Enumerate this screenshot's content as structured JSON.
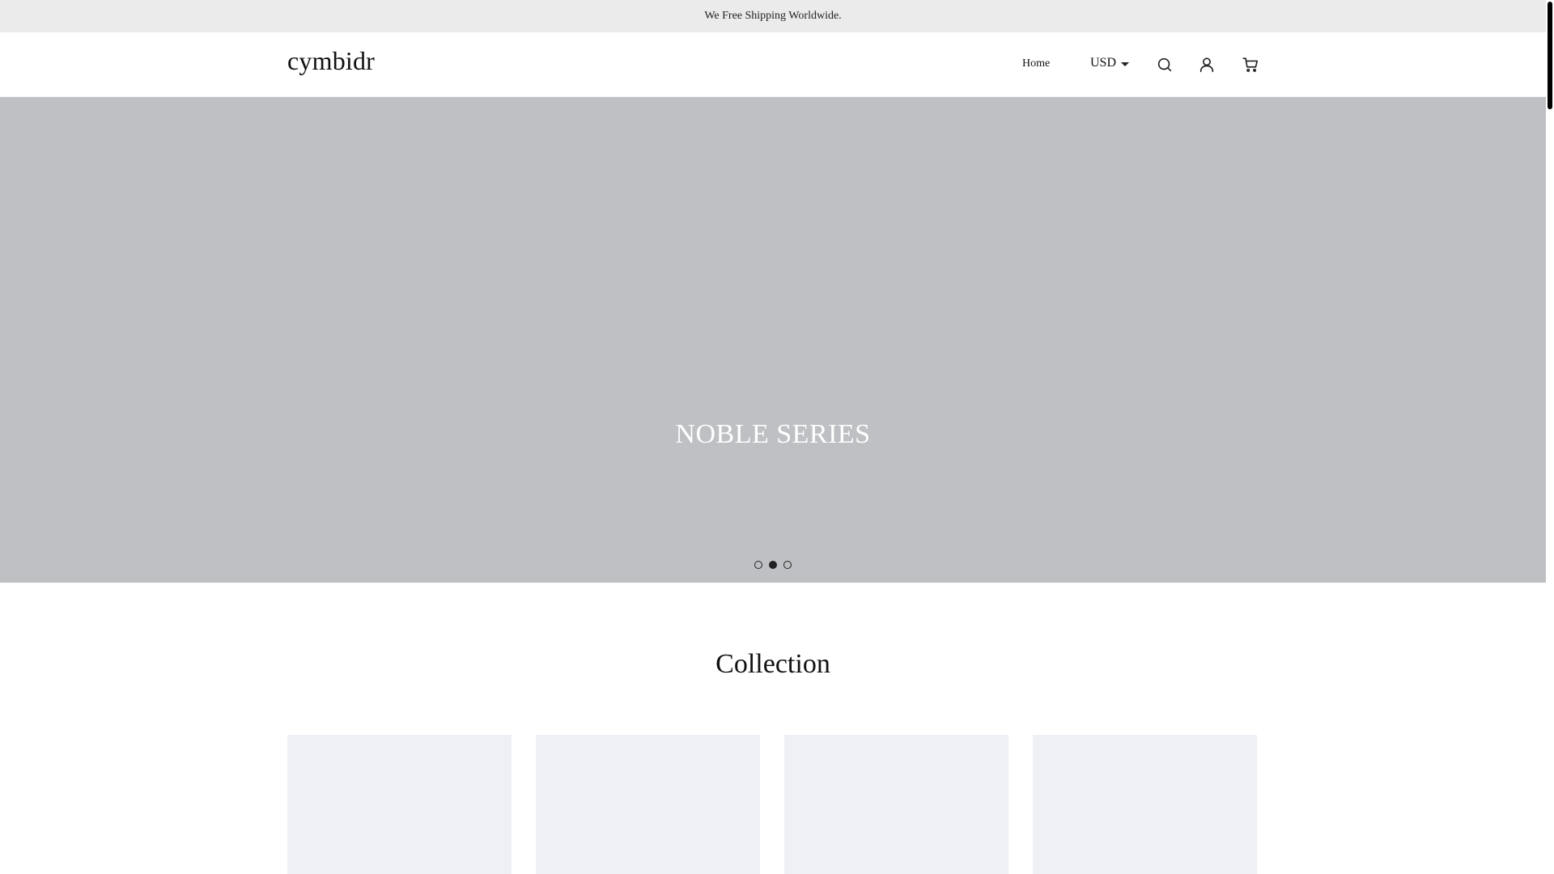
{
  "announcement": {
    "text": "We Free Shipping Worldwide."
  },
  "header": {
    "logo": "cymbidr",
    "nav": {
      "home": "Home"
    },
    "currency": "USD",
    "icons": {
      "search": "search-icon",
      "account": "user-icon",
      "cart": "cart-icon"
    }
  },
  "hero": {
    "title": "NOBLE SERIES",
    "slides": 3,
    "active_slide": 2,
    "background": "#bfc0c4"
  },
  "collection": {
    "title": "Collection",
    "card_count": 4,
    "card_color": "#eef0f5"
  }
}
